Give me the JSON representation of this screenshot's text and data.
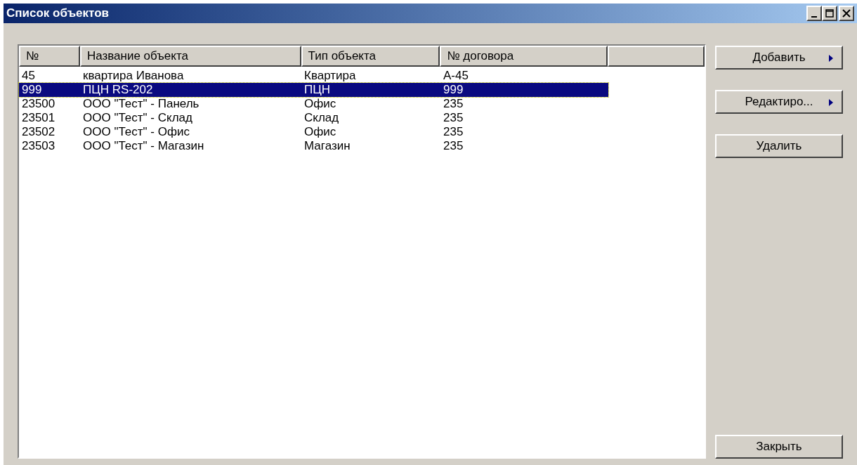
{
  "window": {
    "title": "Список объектов"
  },
  "table": {
    "columns": [
      "№",
      "Название объекта",
      "Тип объекта",
      "№ договора"
    ],
    "rows": [
      {
        "cells": [
          "45",
          "квартира Иванова",
          "Квартира",
          "А-45"
        ],
        "selected": false
      },
      {
        "cells": [
          "999",
          "ПЦН RS-202",
          "ПЦН",
          "999"
        ],
        "selected": true
      },
      {
        "cells": [
          "23500",
          "ООО \"Тест\" - Панель",
          "Офис",
          "235"
        ],
        "selected": false
      },
      {
        "cells": [
          "23501",
          "ООО \"Тест\" - Склад",
          "Склад",
          "235"
        ],
        "selected": false
      },
      {
        "cells": [
          "23502",
          "ООО \"Тест\" - Офис",
          "Офис",
          "235"
        ],
        "selected": false
      },
      {
        "cells": [
          "23503",
          "ООО \"Тест\" - Магазин",
          "Магазин",
          "235"
        ],
        "selected": false
      }
    ]
  },
  "buttons": [
    {
      "label": "Добавить",
      "kind": "menu"
    },
    {
      "label": "Редактиро...",
      "kind": "menu"
    },
    {
      "label": "Удалить",
      "kind": "plain"
    }
  ],
  "close_button": {
    "label": "Закрыть"
  }
}
